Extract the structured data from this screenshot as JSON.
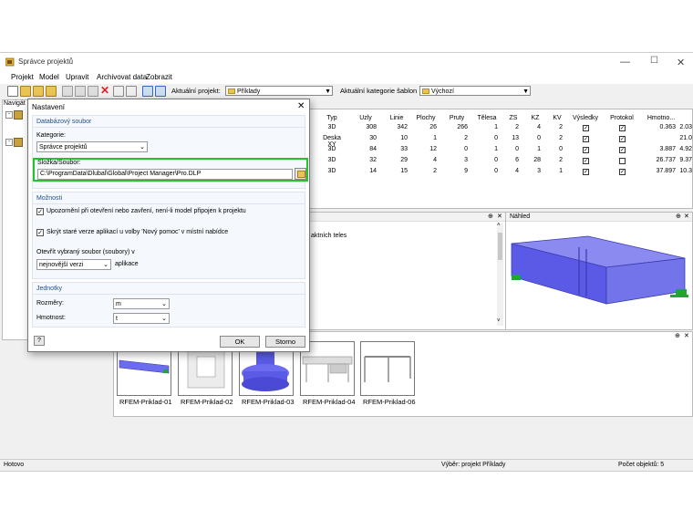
{
  "window": {
    "title": "Správce projektů"
  },
  "menu": [
    "Projekt",
    "Model",
    "Upravit",
    "Archivovat data",
    "Zobrazit"
  ],
  "toolbar": {
    "project_label": "Aktuální projekt:",
    "project_value": "Příklady",
    "template_label": "Aktuální kategorie šablon",
    "template_value": "Výchozí"
  },
  "navigator": {
    "title": "Navigát"
  },
  "table": {
    "headers": [
      "Typ",
      "Uzly",
      "Linie",
      "Plochy",
      "Pruty",
      "Tělesa",
      "ZS",
      "KZ",
      "KV",
      "Výsledky",
      "Protokol",
      "Hmotno..."
    ],
    "rows": [
      {
        "typ": "3D",
        "uzly": "308",
        "linie": "342",
        "plochy": "26",
        "pruty": "266",
        "telesa": "1",
        "zs": "2",
        "kz": "4",
        "kv": "2",
        "vysledky": true,
        "protokol": true,
        "hmot": "0.363",
        "extra": "2.03"
      },
      {
        "typ": "Deska XY",
        "uzly": "30",
        "linie": "10",
        "plochy": "1",
        "pruty": "2",
        "telesa": "0",
        "zs": "13",
        "kz": "0",
        "kv": "2",
        "vysledky": true,
        "protokol": true,
        "hmot": "",
        "extra": "21.0"
      },
      {
        "typ": "3D",
        "uzly": "84",
        "linie": "33",
        "plochy": "12",
        "pruty": "0",
        "telesa": "1",
        "zs": "0",
        "kz": "1",
        "kv": "0",
        "vysledky": true,
        "protokol": true,
        "hmot": "3.887",
        "extra": "4.92"
      },
      {
        "typ": "3D",
        "uzly": "32",
        "linie": "29",
        "plochy": "4",
        "pruty": "3",
        "telesa": "0",
        "zs": "6",
        "kz": "28",
        "kv": "2",
        "vysledky": true,
        "protokol": false,
        "hmot": "26.737",
        "extra": "9.37"
      },
      {
        "typ": "3D",
        "uzly": "14",
        "linie": "15",
        "plochy": "2",
        "pruty": "9",
        "telesa": "0",
        "zs": "4",
        "kz": "3",
        "kv": "1",
        "vysledky": true,
        "protokol": true,
        "hmot": "37.897",
        "extra": "10.3"
      }
    ]
  },
  "details_panel": {
    "text": "aktních teles"
  },
  "preview_panel": {
    "title": "Náhled"
  },
  "thumbnails": [
    "RFEM-Priklad-01",
    "RFEM-Priklad-02",
    "RFEM-Priklad-03",
    "RFEM-Priklad-04",
    "RFEM-Priklad-06"
  ],
  "status": {
    "left": "Hotovo",
    "middle": "Výběr: projekt Příklady",
    "right": "Počet objektů: 5"
  },
  "dialog": {
    "title": "Nastavení",
    "db_group": "Databázový soubor",
    "category_label": "Kategorie:",
    "category_value": "Správce projektů",
    "path_label": "Složka/Soubor:",
    "path_value": "C:\\ProgramData\\Dlubal\\Global\\Project Manager\\Pro.DLP",
    "options_group": "Možnosti",
    "opt1": "Upozornění při otevření nebo zavření, není-li model připojen k projektu",
    "opt2": "Skrýt staré verze aplikací u volby 'Nový pomoc' v místní nabídce",
    "open_label": "Otevřít vybraný soubor (soubory) v",
    "open_value": "nejnovější verzi",
    "open_suffix": "aplikace",
    "units_group": "Jednotky",
    "dim_label": "Rozměry:",
    "dim_value": "m",
    "mass_label": "Hmotnost:",
    "mass_value": "t",
    "ok": "OK",
    "cancel": "Storno"
  },
  "colors": {
    "highlight": "#22c42c",
    "model_blue": "#5a5ae6",
    "support_green": "#1fa82a",
    "group_title": "#1e4e8c"
  }
}
